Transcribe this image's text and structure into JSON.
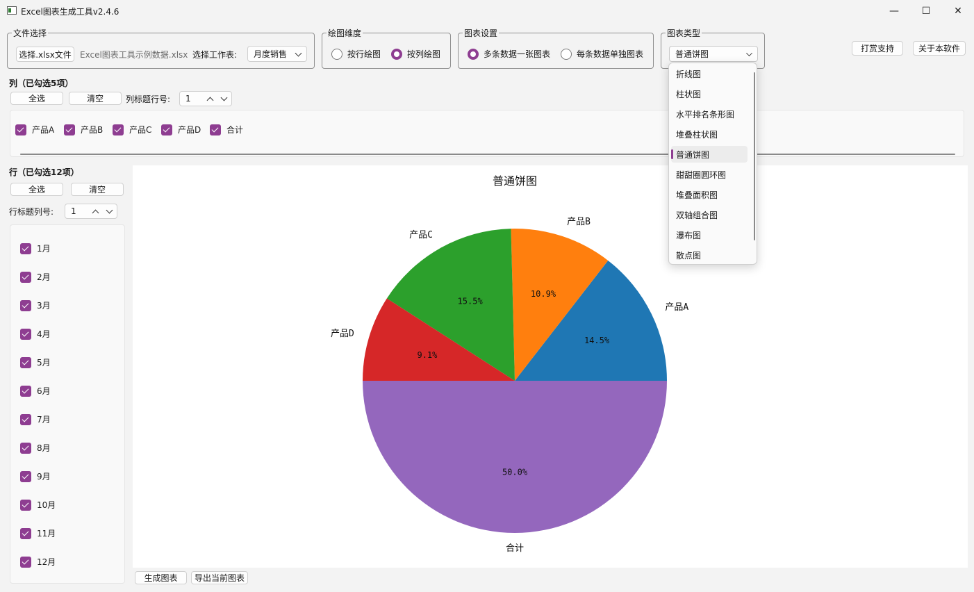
{
  "window": {
    "title": "Excel图表生成工具v2.4.6",
    "minimize": "—",
    "maximize": "☐",
    "close": "✕"
  },
  "file_group": {
    "title": "文件选择",
    "choose_button": "选择.xlsx文件",
    "file_name": "Excel图表工具示例数据.xlsx",
    "sheet_label": "选择工作表:",
    "sheet_value": "月度销售"
  },
  "dimension_group": {
    "title": "绘图维度",
    "by_row": "按行绘图",
    "by_col": "按列绘图",
    "selected": "by_col"
  },
  "settings_group": {
    "title": "图表设置",
    "single": "多条数据一张图表",
    "separate": "每条数据单独图表",
    "selected": "single"
  },
  "type_group": {
    "title": "图表类型",
    "selected": "普通饼图"
  },
  "top_buttons": {
    "donate": "打赏支持",
    "about": "关于本软件"
  },
  "chart_types": [
    "折线图",
    "柱状图",
    "水平排名条形图",
    "堆叠柱状图",
    "普通饼图",
    "甜甜圈圆环图",
    "堆叠面积图",
    "双轴组合图",
    "瀑布图",
    "散点图"
  ],
  "columns": {
    "title": "列（已勾选5项）",
    "select_all": "全选",
    "clear": "清空",
    "header_row_label": "列标题行号:",
    "header_row_value": "1",
    "items": [
      "产品A",
      "产品B",
      "产品C",
      "产品D",
      "合计"
    ]
  },
  "rows": {
    "title": "行（已勾选12项）",
    "select_all": "全选",
    "clear": "清空",
    "header_col_label": "行标题列号:",
    "header_col_value": "1",
    "items": [
      "1月",
      "2月",
      "3月",
      "4月",
      "5月",
      "6月",
      "7月",
      "8月",
      "9月",
      "10月",
      "11月",
      "12月"
    ]
  },
  "bottom_buttons": {
    "generate": "生成图表",
    "export": "导出当前图表"
  },
  "colors": {
    "accent": "#8e3d91"
  },
  "chart_data": {
    "type": "pie",
    "title": "普通饼图",
    "slices": [
      {
        "label": "产品A",
        "value": 14.5,
        "pct": "14.5%",
        "color": "#1f77b4"
      },
      {
        "label": "产品B",
        "value": 10.9,
        "pct": "10.9%",
        "color": "#ff7f0e"
      },
      {
        "label": "产品C",
        "value": 15.5,
        "pct": "15.5%",
        "color": "#2ca02c"
      },
      {
        "label": "产品D",
        "value": 9.1,
        "pct": "9.1%",
        "color": "#d62728"
      },
      {
        "label": "合计",
        "value": 50.0,
        "pct": "50.0%",
        "color": "#9467bd"
      }
    ]
  }
}
